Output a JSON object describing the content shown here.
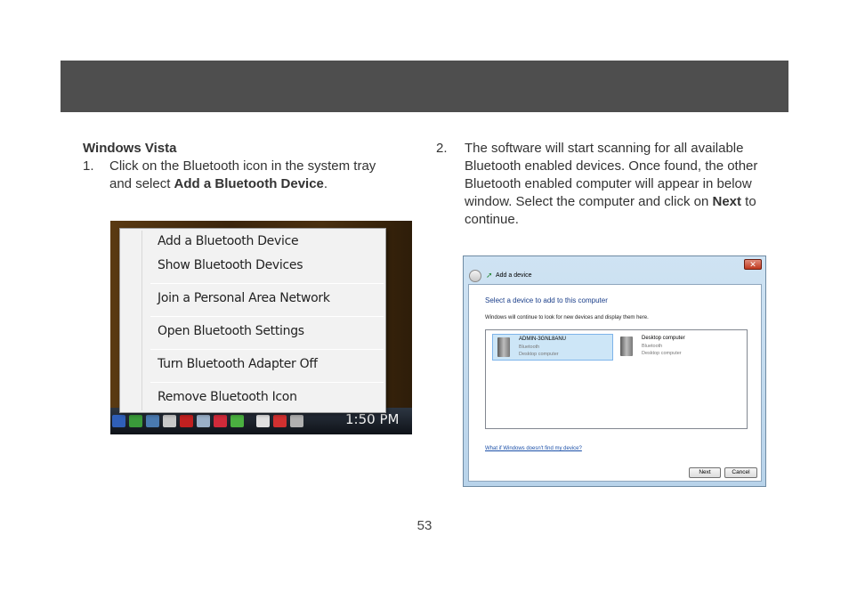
{
  "left": {
    "section_title": "Windows Vista",
    "step1_num": "1.",
    "step1_line1": "Click on the Bluetooth icon in the system tray",
    "step1_prefix": "and select ",
    "step1_bold": "Add a Bluetooth Device",
    "step1_suffix": "."
  },
  "context_menu": {
    "items": [
      "Add a Bluetooth Device",
      "Show Bluetooth Devices",
      "Join a Personal Area Network",
      "Open Bluetooth Settings",
      "Turn Bluetooth Adapter Off",
      "Remove Bluetooth Icon"
    ],
    "tray_time": "1:50 PM"
  },
  "right": {
    "step2_num": "2.",
    "step2_text": "The software will start scanning for all available Bluetooth enabled devices.  Once found, the other Bluetooth enabled computer will appear in below window.  Select the computer and click on ",
    "step2_bold": "Next",
    "step2_suffix": " to continue."
  },
  "dialog": {
    "title": "Add a device",
    "heading": "Select a device to add to this computer",
    "subtext": "Windows will continue to look for new devices and display them here.",
    "devices": [
      {
        "name": "ADMIN-3GNL8ANU",
        "type": "Bluetooth",
        "kind": "Desktop computer"
      },
      {
        "name": "Desktop computer",
        "type": "Bluetooth",
        "kind": "Desktop computer"
      }
    ],
    "help_link": "What if Windows doesn't find my device?",
    "next_label": "Next",
    "cancel_label": "Cancel"
  },
  "page_number": "53"
}
